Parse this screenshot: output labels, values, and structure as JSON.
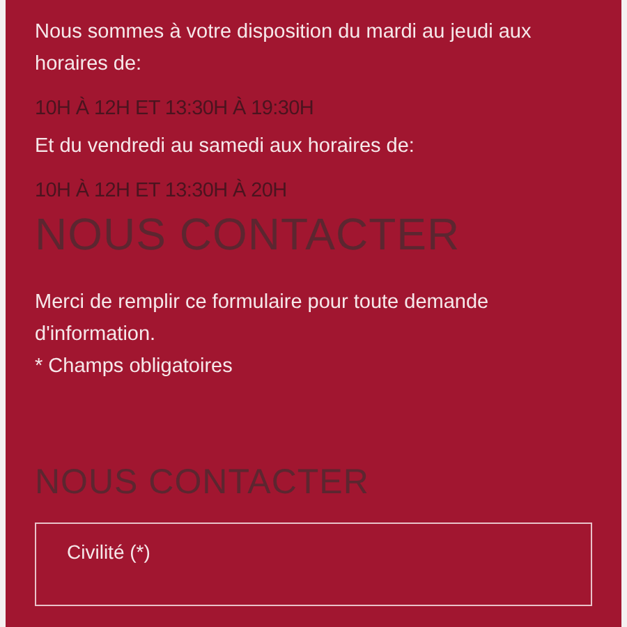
{
  "intro": "Nous sommes à votre disposition du mardi au jeudi aux horaires de:",
  "hours_1": "10H À 12H ET 13:30H À 19:30H",
  "intro_2": "Et du vendredi au samedi aux horaires de:",
  "hours_2": "10H À 12H ET 13:30H À 20H",
  "heading": "NOUS CONTACTER",
  "form_note": "Merci de remplir ce formulaire pour toute demande d'information.",
  "required_note": "* Champs obligatoires",
  "form_heading": "NOUS CONTACTER",
  "fields": [
    {
      "label": "Civilité (*)"
    }
  ]
}
